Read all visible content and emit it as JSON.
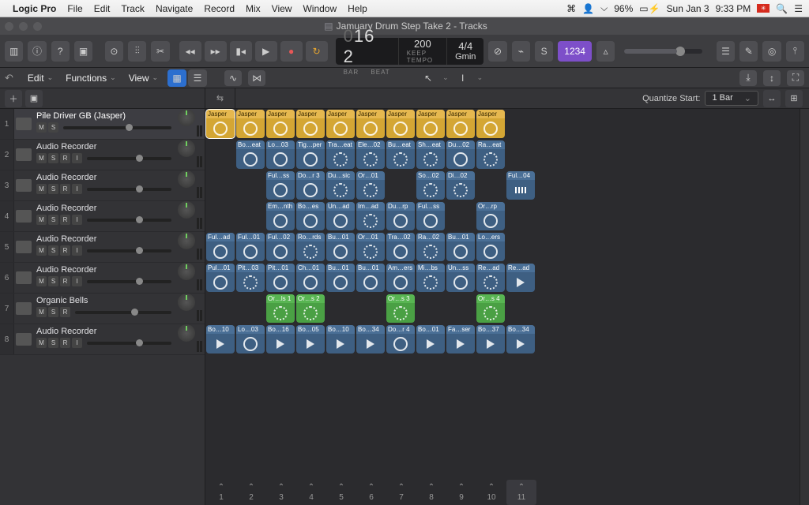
{
  "menubar": {
    "app": "Logic Pro",
    "items": [
      "File",
      "Edit",
      "Track",
      "Navigate",
      "Record",
      "Mix",
      "View",
      "Window",
      "Help"
    ],
    "battery": "96%",
    "date": "Sun Jan 3",
    "time": "9:33 PM"
  },
  "window": {
    "title": "Jamuary Drum Step Take 2 - Tracks"
  },
  "transport": {
    "bar": "16",
    "beat": "2",
    "bar_label": "BAR",
    "beat_label": "BEAT",
    "tempo": "200",
    "tempo_label": "KEEP TEMPO",
    "sig": "4/4",
    "key": "Gmin",
    "count_in": "1234"
  },
  "secbar": {
    "edit": "Edit",
    "functions": "Functions",
    "view": "View"
  },
  "quantize": {
    "label": "Quantize Start:",
    "value": "1 Bar"
  },
  "tracks": [
    {
      "num": "1",
      "name": "Pile Driver GB (Jasper)",
      "msri": [
        "M",
        "S"
      ],
      "selected": true
    },
    {
      "num": "2",
      "name": "Audio Recorder",
      "msri": [
        "M",
        "S",
        "R",
        "I"
      ]
    },
    {
      "num": "3",
      "name": "Audio Recorder",
      "msri": [
        "M",
        "S",
        "R",
        "I"
      ]
    },
    {
      "num": "4",
      "name": "Audio Recorder",
      "msri": [
        "M",
        "S",
        "R",
        "I"
      ]
    },
    {
      "num": "5",
      "name": "Audio Recorder",
      "msri": [
        "M",
        "S",
        "R",
        "I"
      ]
    },
    {
      "num": "6",
      "name": "Audio Recorder",
      "msri": [
        "M",
        "S",
        "R",
        "I"
      ]
    },
    {
      "num": "7",
      "name": "Organic Bells",
      "msri": [
        "M",
        "S",
        "R"
      ]
    },
    {
      "num": "8",
      "name": "Audio Recorder",
      "msri": [
        "M",
        "S",
        "R",
        "I"
      ]
    }
  ],
  "grid": {
    "cols": 11,
    "rows": [
      [
        {
          "c": "yellow",
          "l": "Jasper",
          "i": "ring",
          "sel": true
        },
        {
          "c": "yellow",
          "l": "Jasper",
          "i": "ring"
        },
        {
          "c": "yellow",
          "l": "Jasper",
          "i": "ring"
        },
        {
          "c": "yellow",
          "l": "Jasper",
          "i": "ring"
        },
        {
          "c": "yellow",
          "l": "Jasper",
          "i": "ring"
        },
        {
          "c": "yellow",
          "l": "Jasper",
          "i": "ring"
        },
        {
          "c": "yellow",
          "l": "Jasper",
          "i": "ring"
        },
        {
          "c": "yellow",
          "l": "Jasper",
          "i": "ring"
        },
        {
          "c": "yellow",
          "l": "Jasper",
          "i": "ring"
        },
        {
          "c": "yellow",
          "l": "Jasper",
          "i": "ring"
        },
        null
      ],
      [
        null,
        {
          "c": "blue",
          "l": "Bo…eat",
          "i": "ring"
        },
        {
          "c": "blue",
          "l": "Lo…03",
          "i": "ring"
        },
        {
          "c": "blue",
          "l": "Tig…per",
          "i": "ring"
        },
        {
          "c": "blue",
          "l": "Tra…eat",
          "i": "ringd"
        },
        {
          "c": "blue",
          "l": "Ele…02",
          "i": "ringd"
        },
        {
          "c": "blue",
          "l": "Bu…eat",
          "i": "ringd"
        },
        {
          "c": "blue",
          "l": "Sh…eat",
          "i": "ringd"
        },
        {
          "c": "blue",
          "l": "Du…02",
          "i": "ring"
        },
        {
          "c": "blue",
          "l": "Ra…eat",
          "i": "ringd"
        },
        null
      ],
      [
        null,
        null,
        {
          "c": "blue",
          "l": "Ful…ss",
          "i": "ring"
        },
        {
          "c": "blue",
          "l": "Do…r 3",
          "i": "ring"
        },
        {
          "c": "blue",
          "l": "Du…sic",
          "i": "ringd"
        },
        {
          "c": "blue",
          "l": "Or…01",
          "i": "ringd"
        },
        null,
        {
          "c": "blue",
          "l": "So…02",
          "i": "ringd"
        },
        {
          "c": "blue",
          "l": "Di…02",
          "i": "ringd"
        },
        null,
        {
          "c": "blue",
          "l": "Ful…04",
          "i": "bars"
        }
      ],
      [
        null,
        null,
        {
          "c": "blue",
          "l": "Em…nth",
          "i": "ring"
        },
        {
          "c": "blue",
          "l": "Bo…es",
          "i": "ring"
        },
        {
          "c": "blue",
          "l": "Un…ad",
          "i": "ring"
        },
        {
          "c": "blue",
          "l": "Im…ad",
          "i": "ringd"
        },
        {
          "c": "blue",
          "l": "Du…rp",
          "i": "ring"
        },
        {
          "c": "blue",
          "l": "Ful…ss",
          "i": "ring"
        },
        null,
        {
          "c": "blue",
          "l": "Or…rp",
          "i": "ring"
        },
        null
      ],
      [
        {
          "c": "blue",
          "l": "Ful…ad",
          "i": "ring"
        },
        {
          "c": "blue",
          "l": "Ful…01",
          "i": "ring"
        },
        {
          "c": "blue",
          "l": "Ful…02",
          "i": "ring"
        },
        {
          "c": "blue",
          "l": "Ro…rds",
          "i": "ringd"
        },
        {
          "c": "blue",
          "l": "Bu…01",
          "i": "ring"
        },
        {
          "c": "blue",
          "l": "Or…01",
          "i": "ringd"
        },
        {
          "c": "blue",
          "l": "Tra…02",
          "i": "ring"
        },
        {
          "c": "blue",
          "l": "Ra…02",
          "i": "ringd"
        },
        {
          "c": "blue",
          "l": "Bu…01",
          "i": "ring"
        },
        {
          "c": "blue",
          "l": "Lo…ers",
          "i": "ring"
        },
        null
      ],
      [
        {
          "c": "blue",
          "l": "Pul…01",
          "i": "ring"
        },
        {
          "c": "blue",
          "l": "Pit…03",
          "i": "ringd"
        },
        {
          "c": "blue",
          "l": "Pit…01",
          "i": "ring"
        },
        {
          "c": "blue",
          "l": "Ch…01",
          "i": "ring"
        },
        {
          "c": "blue",
          "l": "Bu…01",
          "i": "ring"
        },
        {
          "c": "blue",
          "l": "Bu…01",
          "i": "ring"
        },
        {
          "c": "blue",
          "l": "Am…ers",
          "i": "ring"
        },
        {
          "c": "blue",
          "l": "Mi…bs",
          "i": "ringd"
        },
        {
          "c": "blue",
          "l": "Un…ss",
          "i": "ring"
        },
        {
          "c": "blue",
          "l": "Re…ad",
          "i": "ringd"
        },
        {
          "c": "blue",
          "l": "Re…ad",
          "i": "play"
        }
      ],
      [
        null,
        null,
        {
          "c": "green",
          "l": "Or…ls 1",
          "i": "ringd"
        },
        {
          "c": "green",
          "l": "Or…s 2",
          "i": "ringd"
        },
        null,
        null,
        {
          "c": "green",
          "l": "Or…s 3",
          "i": "ringd"
        },
        null,
        null,
        {
          "c": "green",
          "l": "Or…s 4",
          "i": "ringd"
        },
        null
      ],
      [
        {
          "c": "blue",
          "l": "Bo…10",
          "i": "play"
        },
        {
          "c": "blue",
          "l": "Lo…03",
          "i": "ring"
        },
        {
          "c": "blue",
          "l": "Bo…16",
          "i": "play"
        },
        {
          "c": "blue",
          "l": "Bo…05",
          "i": "play"
        },
        {
          "c": "blue",
          "l": "Bo…10",
          "i": "play"
        },
        {
          "c": "blue",
          "l": "Bo…34",
          "i": "play"
        },
        {
          "c": "blue",
          "l": "Do…r 4",
          "i": "ring"
        },
        {
          "c": "blue",
          "l": "Bo…01",
          "i": "play"
        },
        {
          "c": "blue",
          "l": "Fa…ser",
          "i": "play"
        },
        {
          "c": "blue",
          "l": "Bo…37",
          "i": "play"
        },
        {
          "c": "blue",
          "l": "Bo…34",
          "i": "play"
        }
      ]
    ],
    "footer": [
      "1",
      "2",
      "3",
      "4",
      "5",
      "6",
      "7",
      "8",
      "9",
      "10",
      "11"
    ]
  }
}
